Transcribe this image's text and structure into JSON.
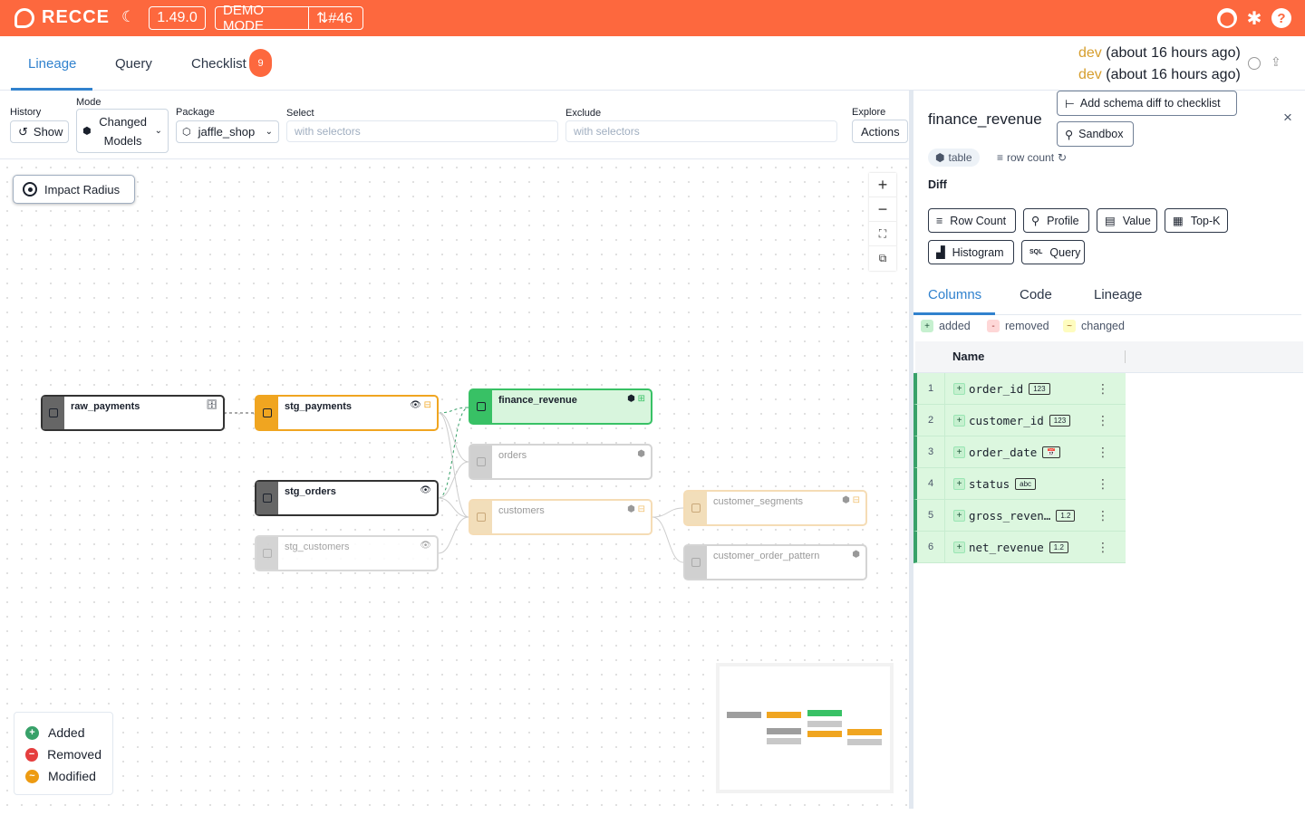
{
  "topbar": {
    "brand": "RECCE",
    "version": "1.49.0",
    "demo_mode": "DEMO MODE",
    "pr": "⇅#46"
  },
  "tabs": {
    "lineage": "Lineage",
    "query": "Query",
    "checklist": "Checklist",
    "checklist_count": "9"
  },
  "envs": {
    "base_name": "dev",
    "base_time": "(about 16 hours ago)",
    "current_name": "dev",
    "current_time": "(about 16 hours ago)"
  },
  "controls": {
    "history_label": "History",
    "history_btn": "Show",
    "mode_label": "Mode",
    "mode_line1": "Changed",
    "mode_line2": "Models",
    "package_label": "Package",
    "package_value": "jaffle_shop",
    "select_label": "Select",
    "select_placeholder": "with selectors",
    "exclude_label": "Exclude",
    "exclude_placeholder": "with selectors",
    "explore_label": "Explore",
    "explore_btn": "Actions"
  },
  "canvas": {
    "impact_radius": "Impact Radius",
    "nodes": {
      "raw_payments": "raw_payments",
      "stg_payments": "stg_payments",
      "stg_orders": "stg_orders",
      "stg_customers": "stg_customers",
      "finance_revenue": "finance_revenue",
      "orders": "orders",
      "customers": "customers",
      "customer_segments": "customer_segments",
      "customer_order_pattern": "customer_order_pattern"
    },
    "legend": {
      "added": "Added",
      "removed": "Removed",
      "modified": "Modified"
    },
    "colors": {
      "added": "#38a169",
      "removed": "#e53e3e",
      "modified": "#ed9b12"
    }
  },
  "panel": {
    "title": "finance_revenue",
    "add_schema_diff": "Add schema diff to checklist",
    "sandbox": "Sandbox",
    "tag_table": "table",
    "tag_row_count": "row count",
    "diff_heading": "Diff",
    "diff_buttons": {
      "row_count": "Row Count",
      "profile": "Profile",
      "value": "Value",
      "topk": "Top-K",
      "histogram": "Histogram",
      "query": "Query"
    },
    "tabs": {
      "columns": "Columns",
      "code": "Code",
      "lineage": "Lineage"
    },
    "pills": {
      "added": "added",
      "removed": "removed",
      "changed": "changed"
    },
    "grid_header": "Name",
    "rows": [
      {
        "num": "1",
        "name": "order_id",
        "type": "123"
      },
      {
        "num": "2",
        "name": "customer_id",
        "type": "123"
      },
      {
        "num": "3",
        "name": "order_date",
        "type": "📅"
      },
      {
        "num": "4",
        "name": "status",
        "type": "abc"
      },
      {
        "num": "5",
        "name": "gross_reven…",
        "type": "1.2"
      },
      {
        "num": "6",
        "name": "net_revenue",
        "type": "1.2"
      }
    ]
  }
}
